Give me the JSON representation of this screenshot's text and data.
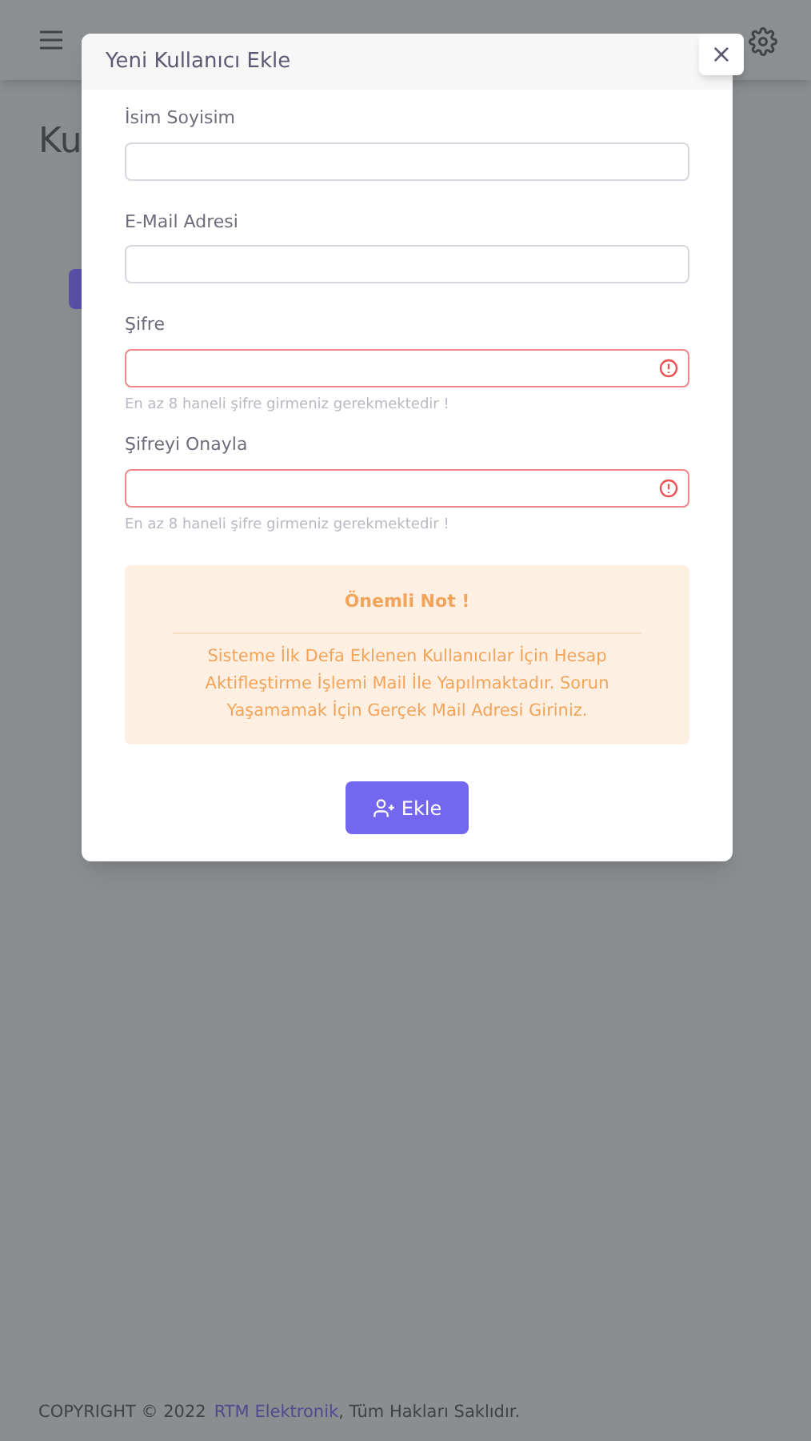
{
  "page": {
    "title": "Ku"
  },
  "modal": {
    "title": "Yeni Kullanıcı Ekle",
    "close": "×",
    "fields": [
      {
        "label": "İsim Soyisim",
        "invalid": false
      },
      {
        "label": "E-Mail Adresi",
        "invalid": false
      },
      {
        "label": "Şifre",
        "invalid": true,
        "error": "En az 8 haneli şifre girmeniz gerekmektedir !"
      },
      {
        "label": "Şifreyi Onayla",
        "invalid": true,
        "error": "En az 8 haneli şifre girmeniz gerekmektedir !"
      }
    ],
    "alert": {
      "title": "Önemli Not !",
      "body": "Sisteme İlk Defa Eklenen Kullanıcılar İçin Hesap Aktifleştirme İşlemi Mail İle Yapılmaktadır. Sorun Yaşamamak İçin Gerçek Mail Adresi Giriniz."
    },
    "submit": "Ekle"
  },
  "footer": {
    "copyright": "COPYRIGHT © 2022",
    "link": "RTM Elektronik",
    "rest": ", Tüm Hakları Saklıdır."
  }
}
